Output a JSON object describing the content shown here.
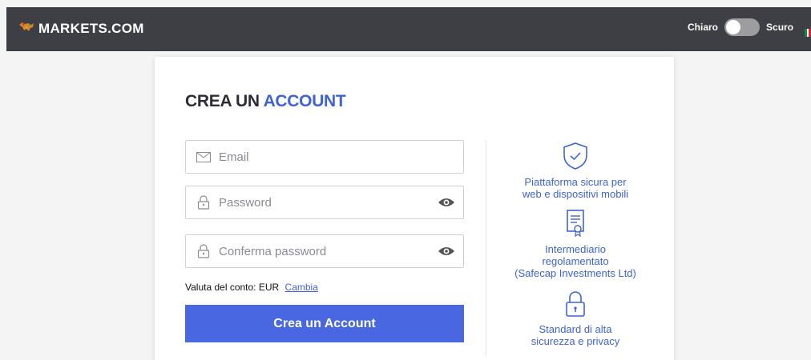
{
  "header": {
    "brand": "MARKETS.COM",
    "theme_light": "Chiaro",
    "theme_dark": "Scuro",
    "flag_colors": [
      "#009246",
      "#ffffff",
      "#ce2b37"
    ]
  },
  "form": {
    "title_main": "CREA UN",
    "title_accent": "ACCOUNT",
    "email_placeholder": "Email",
    "password_placeholder": "Password",
    "confirm_placeholder": "Conferma password",
    "currency_label": "Valuta del conto:",
    "currency_value": "EUR",
    "change_link": "Cambia",
    "submit_label": "Crea un Account"
  },
  "features": [
    {
      "icon": "shield-check-icon",
      "line1": "Piattaforma sicura per",
      "line2": "web e dispositivi mobili"
    },
    {
      "icon": "certificate-icon",
      "line1": "Intermediario",
      "line2": "regolamentato",
      "line3": "(Safecap Investments Ltd)"
    },
    {
      "icon": "padlock-icon",
      "line1": "Standard di alta",
      "line2": "sicurezza e privacy"
    }
  ],
  "colors": {
    "accent": "#3f63d4",
    "button": "#4867e0",
    "header_bg": "#3e3f44"
  }
}
